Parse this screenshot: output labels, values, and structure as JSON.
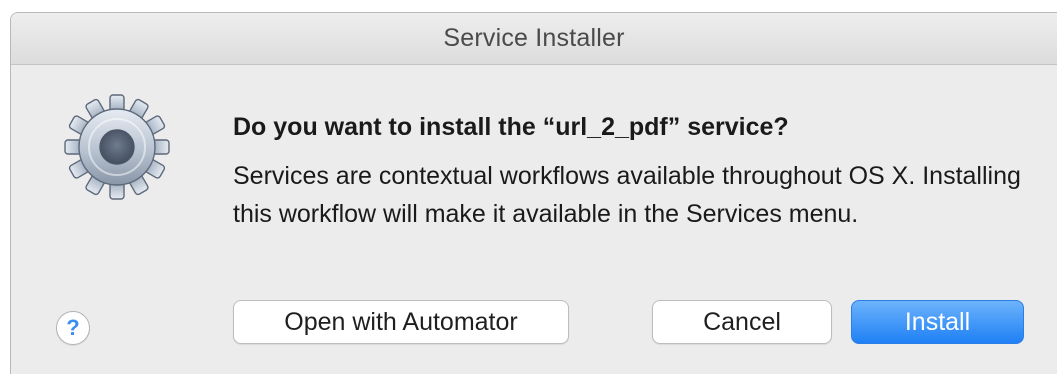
{
  "window": {
    "title": "Service Installer"
  },
  "dialog": {
    "icon": "gear-icon",
    "heading": "Do you want to install the “url_2_pdf” service?",
    "message": "Services are contextual workflows available throughout OS X. Installing this workflow will make it available in the Services menu."
  },
  "buttons": {
    "help_label": "?",
    "open_label": "Open with Automator",
    "cancel_label": "Cancel",
    "install_label": "Install"
  },
  "colors": {
    "accent": "#1f80f5",
    "help_glyph": "#3b8df6",
    "window_bg": "#ececec"
  }
}
